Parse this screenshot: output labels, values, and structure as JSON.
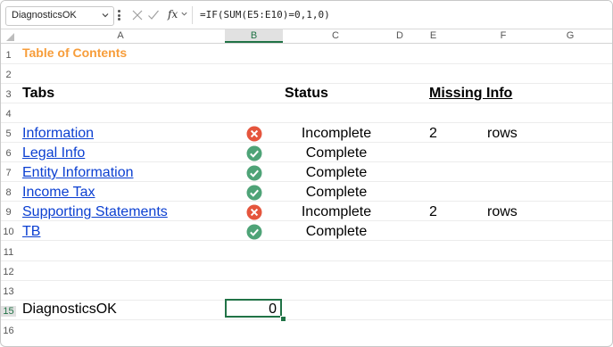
{
  "formula_bar": {
    "name_box": "DiagnosticsOK",
    "fx_label": "fx",
    "formula": "=IF(SUM(E5:E10)=0,1,0)"
  },
  "columns": [
    "A",
    "B",
    "C",
    "D",
    "E",
    "F",
    "G"
  ],
  "rows": [
    "1",
    "2",
    "3",
    "4",
    "5",
    "6",
    "7",
    "8",
    "9",
    "10",
    "11",
    "12",
    "13",
    "15",
    "16"
  ],
  "sheet": {
    "title": "Table of Contents",
    "headers": {
      "tabs": "Tabs",
      "status": "Status",
      "missing": "Missing Info"
    },
    "items": [
      {
        "tab": "Information",
        "status_icon": "error-icon",
        "status": "Incomplete",
        "missing": "2",
        "unit": "rows"
      },
      {
        "tab": "Legal Info",
        "status_icon": "check-icon",
        "status": "Complete",
        "missing": "",
        "unit": ""
      },
      {
        "tab": "Entity Information",
        "status_icon": "check-icon",
        "status": "Complete",
        "missing": "",
        "unit": ""
      },
      {
        "tab": "Income Tax",
        "status_icon": "check-icon",
        "status": "Complete",
        "missing": "",
        "unit": ""
      },
      {
        "tab": "Supporting Statements",
        "status_icon": "error-icon",
        "status": "Incomplete",
        "missing": "2",
        "unit": "rows"
      },
      {
        "tab": "TB",
        "status_icon": "check-icon",
        "status": "Complete",
        "missing": "",
        "unit": ""
      }
    ],
    "diagnostics_label": "DiagnosticsOK",
    "diagnostics_value": "0"
  },
  "colors": {
    "accent": "#217346",
    "title": "#f79d3a",
    "link": "#0b3fd1",
    "error": "#e5553d",
    "ok": "#4ea377"
  }
}
